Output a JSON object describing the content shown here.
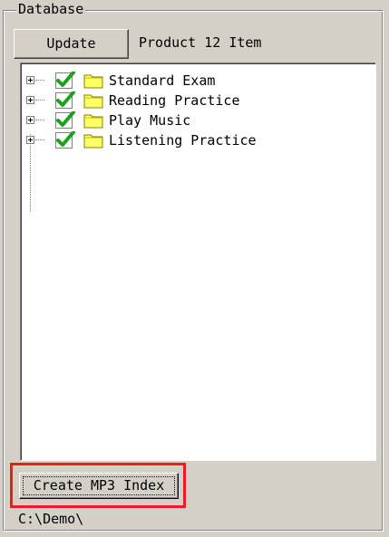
{
  "group": {
    "title": "Database"
  },
  "toolbar": {
    "update_label": "Update",
    "product_count": "Product 12 Item"
  },
  "tree": {
    "items": [
      {
        "label": "Standard Exam",
        "checked": true,
        "expanded": false
      },
      {
        "label": "Reading Practice",
        "checked": true,
        "expanded": false
      },
      {
        "label": "Play Music",
        "checked": true,
        "expanded": false
      },
      {
        "label": "Listening Practice",
        "checked": true,
        "expanded": false
      }
    ]
  },
  "footer": {
    "create_label": "Create MP3 Index",
    "path": "C:\\Demo\\"
  },
  "colors": {
    "window_bg": "#d4d0c8",
    "check_green": "#1aa31a",
    "folder_yellow": "#ffff66",
    "highlight_red": "#ee1c1c"
  },
  "icons": {
    "expander": "plus-box-icon",
    "checkbox": "checkmark-icon",
    "folder": "folder-icon"
  }
}
